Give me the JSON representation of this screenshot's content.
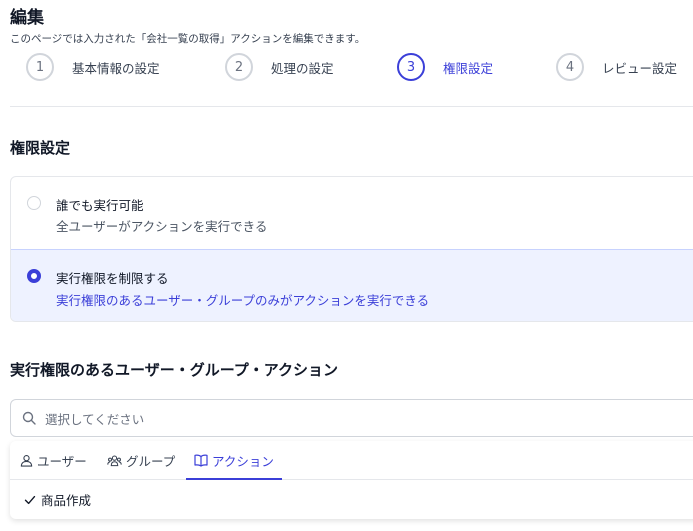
{
  "header": {
    "title": "編集",
    "description": "このページでは入力された「会社一覧の取得」アクションを編集できます。"
  },
  "steps": [
    {
      "number": "1",
      "label": "基本情報の設定"
    },
    {
      "number": "2",
      "label": "処理の設定"
    },
    {
      "number": "3",
      "label": "権限設定"
    },
    {
      "number": "4",
      "label": "レビュー設定"
    }
  ],
  "active_step": 3,
  "permission": {
    "title": "権限設定",
    "options": [
      {
        "title": "誰でも実行可能",
        "description": "全ユーザーがアクションを実行できる",
        "selected": false
      },
      {
        "title": "実行権限を制限する",
        "description": "実行権限のあるユーザー・グループのみがアクションを実行できる",
        "selected": true
      }
    ]
  },
  "access": {
    "title": "実行権限のあるユーザー・グループ・アクション",
    "search_placeholder": "選択してください",
    "tabs": [
      {
        "label": "ユーザー",
        "icon": "user-icon"
      },
      {
        "label": "グループ",
        "icon": "group-icon"
      },
      {
        "label": "アクション",
        "icon": "book-icon"
      }
    ],
    "active_tab": "アクション",
    "items": [
      {
        "label": "商品作成",
        "checked": true
      }
    ]
  },
  "colors": {
    "accent": "#3b3fd8",
    "selected_bg": "#eef2ff",
    "border": "#e5e7eb"
  }
}
